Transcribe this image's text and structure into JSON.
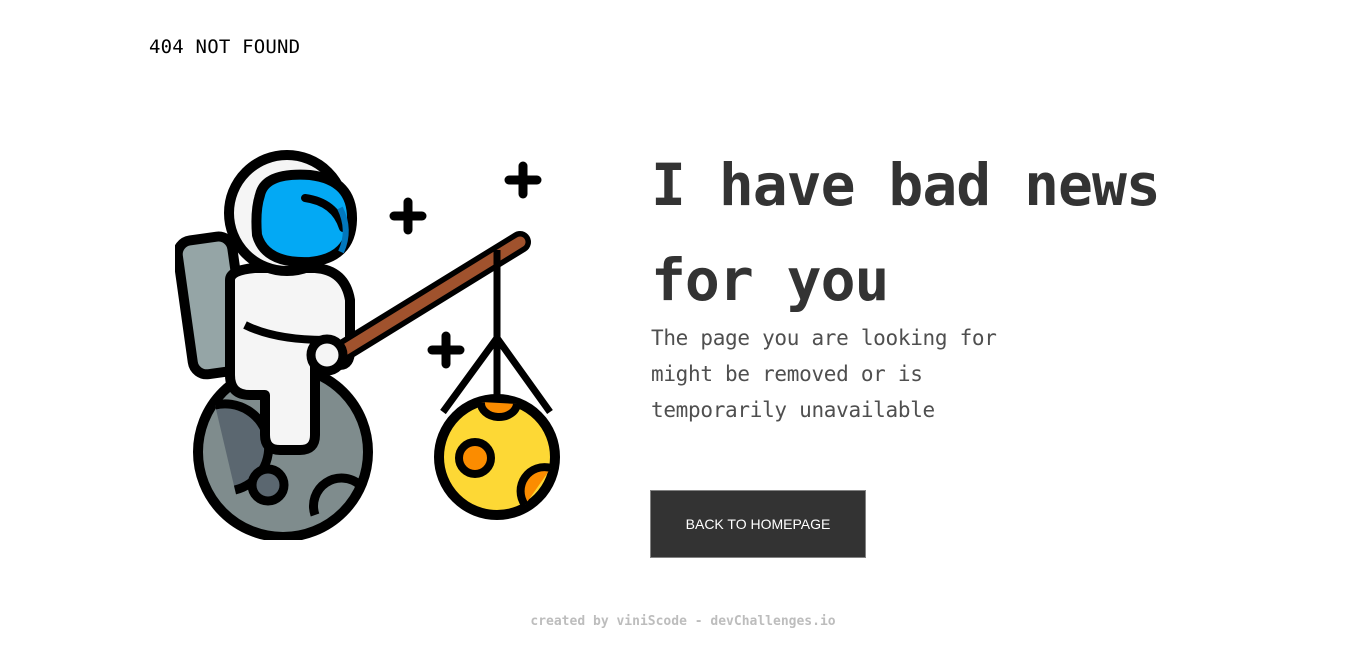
{
  "header": {
    "logo_text": "404 NOT FOUND"
  },
  "main": {
    "headline": "I have bad news for you",
    "description": "The page you are looking for might be removed or is temporarily unavailable",
    "cta_label": "BACK TO HOMEPAGE",
    "illustration_icon": "astronaut-fishing-planet-icon"
  },
  "footer": {
    "credit": "created by viniScode - devChallenges.io"
  },
  "colors": {
    "text_dark": "#333333",
    "text_body": "#4f4f4f",
    "button_bg": "#333333",
    "button_text": "#ffffff",
    "footer_text": "#bdbdbd",
    "visor_blue": "#03a9f4",
    "planet_gray": "#7f8c8d",
    "moon_yellow": "#fdd835",
    "rod_brown": "#a0522d"
  }
}
